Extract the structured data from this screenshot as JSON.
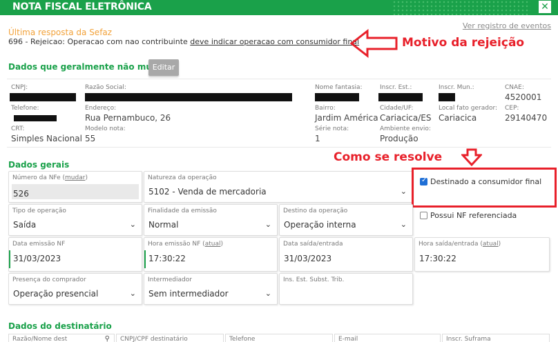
{
  "header": {
    "title": "NOTA FISCAL ELETRÔNICA",
    "close_icon": "close-icon"
  },
  "events_link": "Ver registro de eventos",
  "sefaz": {
    "title": "Última resposta da Sefaz",
    "msg_prefix": "696 - Rejeicao: Operacao com nao contribuinte ",
    "msg_highlight": "deve indicar operacao com consumidor final"
  },
  "annotations": {
    "motivo": "Motivo da rejeição",
    "resolve": "Como se resolve",
    "color": "#e8202a"
  },
  "fixed": {
    "title": "Dados que geralmente não mudam",
    "edit_label": "Editar",
    "cnpj_label": "CNPJ:",
    "razao_label": "Razão Social:",
    "fantasia_label": "Nome fantasia:",
    "inscr_est_label": "Inscr. Est.:",
    "inscr_mun_label": "Inscr. Mun.:",
    "cnae_label": "CNAE:",
    "cnae_value": "4520001",
    "telefone_label": "Telefone:",
    "endereco_label": "Endereço:",
    "endereco_value": "Rua Pernambuco, 26",
    "bairro_label": "Bairro:",
    "bairro_value": "Jardim América",
    "cidade_label": "Cidade/UF:",
    "cidade_value": "Cariacica/ES",
    "local_label": "Local fato gerador:",
    "local_value": "Cariacica",
    "cep_label": "CEP:",
    "cep_value": "29140470",
    "crt_label": "CRT:",
    "crt_value": "Simples Nacional",
    "modelo_label": "Modelo nota:",
    "modelo_value": "55",
    "serie_label": "Série nota:",
    "serie_value": "1",
    "ambiente_label": "Ambiente envio:",
    "ambiente_value": "Produção"
  },
  "general": {
    "title": "Dados gerais",
    "numero_label": "Número da NFe (",
    "numero_link": "mudar",
    "numero_label_end": ")",
    "numero_value": "526",
    "natureza_label": "Natureza da operação",
    "natureza_value": "5102 - Venda de mercadoria",
    "consumidor_final_label": "Destinado a consumidor final",
    "consumidor_final_checked": true,
    "nf_referenciada_label": "Possui NF referenciada",
    "nf_referenciada_checked": false,
    "tipo_label": "Tipo de operação",
    "tipo_value": "Saída",
    "finalidade_label": "Finalidade da emissão",
    "finalidade_value": "Normal",
    "destino_label": "Destino da operação",
    "destino_value": "Operação interna",
    "data_emissao_label": "Data emissão NF",
    "data_emissao_value": "31/03/2023",
    "hora_emissao_label": "Hora emissão NF (",
    "hora_emissao_link": "atual",
    "hora_emissao_value": "17:30:22",
    "data_saida_label": "Data saída/entrada",
    "data_saida_value": "31/03/2023",
    "hora_saida_label": "Hora saída/entrada (",
    "hora_saida_link": "atual",
    "hora_saida_value": "17:30:22",
    "presenca_label": "Presença do comprador",
    "presenca_value": "Operação presencial",
    "intermediador_label": "Intermediador",
    "intermediador_value": "Sem intermediador",
    "ins_est_subst_label": "Ins. Est. Subst. Trib."
  },
  "destinatario": {
    "title": "Dados do destinatário",
    "cols": [
      "Razão/Nome dest",
      "CNPJ/CPF destinatário",
      "Telefone",
      "E-mail",
      "Inscr. Suframa"
    ]
  },
  "colors": {
    "brand_green": "#1aa14a",
    "orange": "#f2a23a",
    "annotation_red": "#e8202a"
  }
}
